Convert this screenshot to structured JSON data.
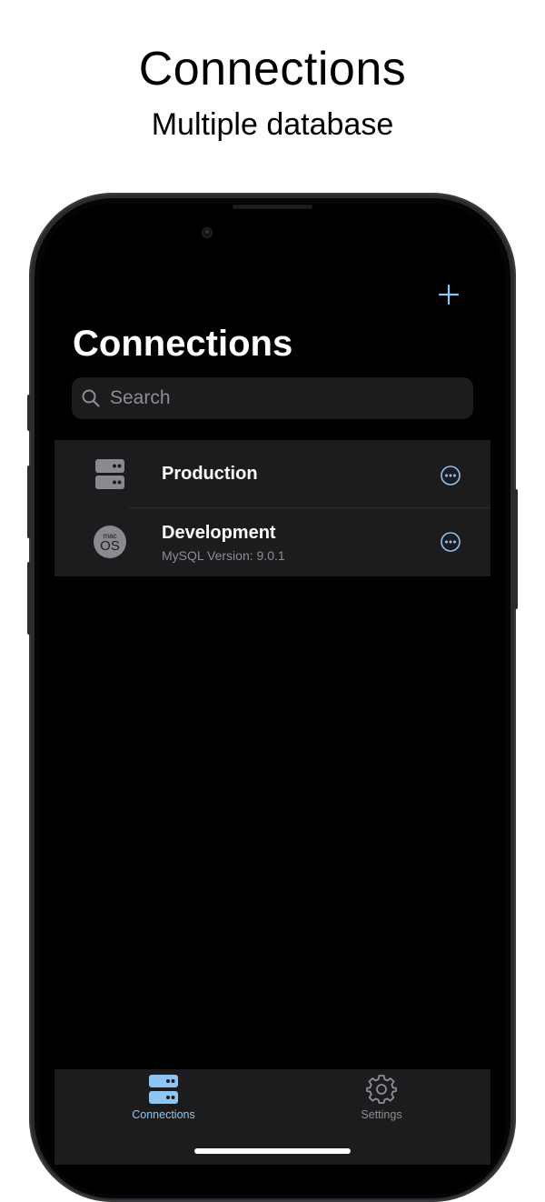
{
  "promo": {
    "title": "Connections",
    "subtitle": "Multiple database"
  },
  "nav": {
    "add_icon": "plus-icon",
    "title": "Connections"
  },
  "search": {
    "placeholder": "Search",
    "value": ""
  },
  "connections": [
    {
      "name": "Production",
      "subtitle": "",
      "icon": "server-icon"
    },
    {
      "name": "Development",
      "subtitle": "MySQL Version: 9.0.1",
      "icon": "macos-icon",
      "icon_text_top": "mac",
      "icon_text_bottom": "OS"
    }
  ],
  "tabs": [
    {
      "label": "Connections",
      "icon": "server-icon",
      "active": true
    },
    {
      "label": "Settings",
      "icon": "gear-icon",
      "active": false
    }
  ],
  "colors": {
    "accent": "#8ec5f2",
    "background": "#000000",
    "cell": "#1c1c1e",
    "secondary_text": "#8e8e93"
  }
}
